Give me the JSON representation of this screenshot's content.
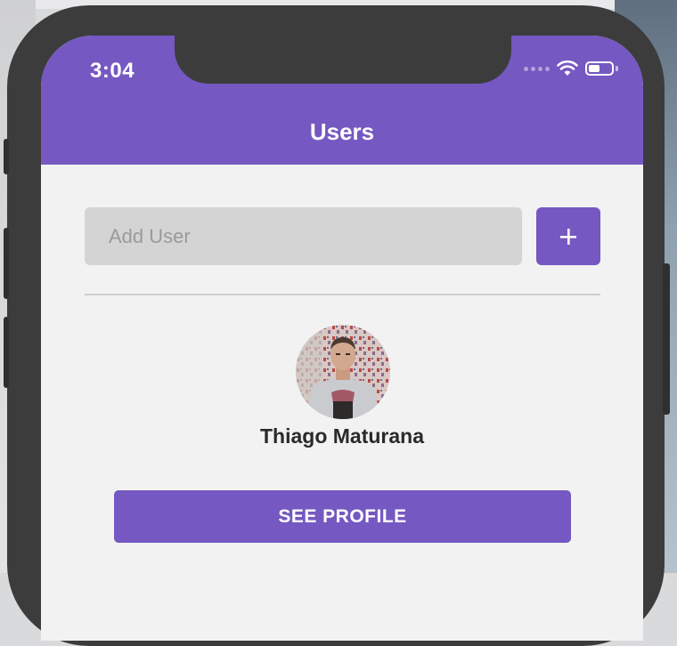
{
  "status_bar": {
    "time": "3:04"
  },
  "header": {
    "title": "Users"
  },
  "add_user": {
    "placeholder": "Add User",
    "value": "",
    "button_icon": "plus-icon"
  },
  "user_card": {
    "name": "Thiago Maturana",
    "avatar": "user-photo",
    "see_profile_label": "SEE PROFILE"
  },
  "colors": {
    "accent": "#7558c1",
    "input_bg": "#d4d4d4",
    "screen_bg": "#f2f2f2",
    "phone_frame": "#3c3c3d"
  }
}
